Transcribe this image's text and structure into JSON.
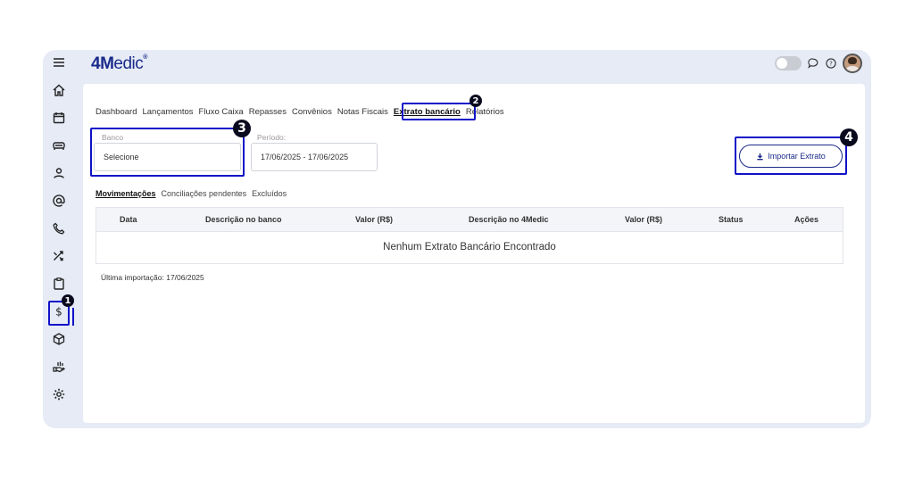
{
  "app": {
    "logo_main": "4M",
    "logo_tail": "edic",
    "logo_reg": "®"
  },
  "sidebar": {
    "items": [
      {
        "icon": "menu-icon"
      },
      {
        "icon": "home-icon"
      },
      {
        "icon": "calendar-icon"
      },
      {
        "icon": "car-icon"
      },
      {
        "icon": "user-icon"
      },
      {
        "icon": "at-icon"
      },
      {
        "icon": "phone-icon"
      },
      {
        "icon": "shuffle-icon"
      },
      {
        "icon": "clipboard-icon"
      },
      {
        "icon": "dollar-icon"
      },
      {
        "icon": "package-icon"
      },
      {
        "icon": "hand-icon"
      },
      {
        "icon": "settings-icon"
      }
    ]
  },
  "nav": {
    "tabs": [
      "Dashboard",
      "Lançamentos",
      "Fluxo Caixa",
      "Repasses",
      "Convênios",
      "Notas Fiscais",
      "Extrato bancário",
      "Relatórios"
    ],
    "active": "Extrato bancário"
  },
  "filters": {
    "bank_label": "Banco",
    "bank_value": "Selecione",
    "period_label": "Período:",
    "period_value": "17/06/2025 - 17/06/2025"
  },
  "import_button": {
    "label": "Importar Extrato"
  },
  "subtabs": {
    "items": [
      "Movimentações",
      "Conciliações pendentes",
      "Excluídos"
    ],
    "active": "Movimentações"
  },
  "table": {
    "columns": [
      "Data",
      "Descrição no banco",
      "Valor (R$)",
      "Descrição no 4Medic",
      "Valor (R$)",
      "Status",
      "Ações"
    ],
    "empty_message": "Nenhum Extrato Bancário Encontrado"
  },
  "last_import": "Última importação: 17/06/2025",
  "annotations": {
    "markers": [
      "1",
      "2",
      "3",
      "4"
    ],
    "highlight_color": "#1010c8"
  },
  "colors": {
    "brand": "#1a2a8a",
    "frame_bg": "#e6ebf6"
  }
}
